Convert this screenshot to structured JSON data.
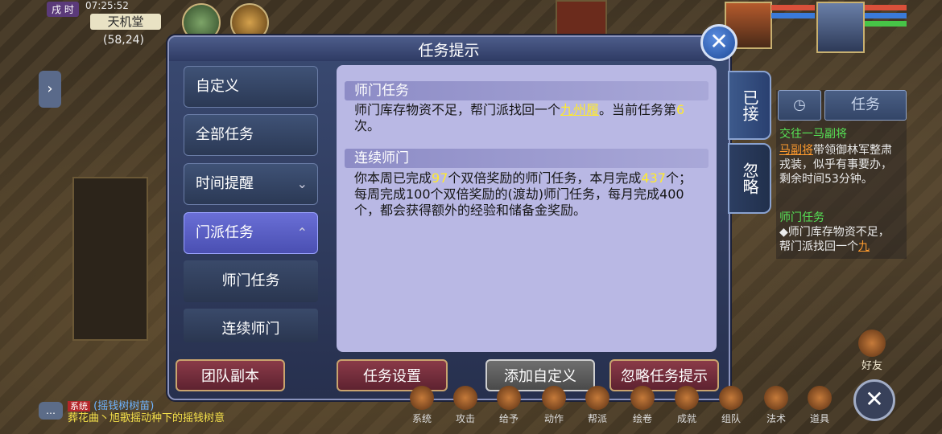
{
  "status": {
    "time_badge": "戌 时",
    "clock": "07:25:52",
    "map_name": "天机堂",
    "coords": "(58,24)"
  },
  "modal": {
    "title": "任务提示",
    "close_symbol": "✕"
  },
  "nav": {
    "items": [
      {
        "label": "自定义"
      },
      {
        "label": "全部任务"
      },
      {
        "label": "时间提醒",
        "chevron": "⌄"
      },
      {
        "label": "门派任务",
        "chevron": "⌃"
      }
    ],
    "sub_items": [
      {
        "label": "师门任务"
      },
      {
        "label": "连续师门"
      }
    ]
  },
  "content": {
    "sections": [
      {
        "title": "师门任务",
        "body_1": "师门库存物资不足，帮门派找回一个",
        "highlight_item": "九州履",
        "body_2": "。当前任务第",
        "count": "6",
        "body_3": "次。"
      },
      {
        "title": "连续师门",
        "body_1": "你本周已完成",
        "week_count": "97",
        "body_2": "个双倍奖励的师门任务，本月完成",
        "month_count": "437",
        "body_3": "个；每周完成100个双倍奖励的(渡劫)师门任务，每月完成400个，都会获得额外的经验和储备金奖励。"
      }
    ]
  },
  "side_tabs": {
    "accepted": "已接",
    "ignored": "忽略"
  },
  "footer": {
    "team_dungeon": "团队副本",
    "task_settings": "任务设置",
    "add_custom": "添加自定义",
    "ignore_tips": "忽略任务提示"
  },
  "tracker": {
    "tab_label": "任务",
    "lines": [
      {
        "text": "交往一马副将",
        "color": "green"
      },
      {
        "text": "马副将",
        "color": "orange"
      },
      {
        "text": "带领御林军整肃戎装，似乎有事要办，剩余时间53分钟",
        "color": "white"
      },
      {
        "text": "。",
        "color": "white"
      },
      {
        "text": "师门任务",
        "color": "green"
      },
      {
        "text": "◆师门库存物资不足，帮门派找回一个",
        "color": "white"
      },
      {
        "text": "九",
        "color": "orange"
      }
    ]
  },
  "bottom_bar": {
    "items": [
      "系统",
      "攻击",
      "给予",
      "动作",
      "帮派",
      "绘卷",
      "成就",
      "组队",
      "法术",
      "道具"
    ],
    "friend_label": "好友",
    "exit_symbol": "✕"
  },
  "chat": {
    "channel": "系统",
    "line_1": "(摇钱树树苗)",
    "line_2": "葬花曲丶旭歌摇动种下的摇钱树意",
    "icon_symbol": "…"
  },
  "colors": {
    "modal_bg": "#27304e",
    "content_bg": "#b9b8e4",
    "active_nav": "#6a6fd6",
    "highlight": "#ffea2e"
  }
}
